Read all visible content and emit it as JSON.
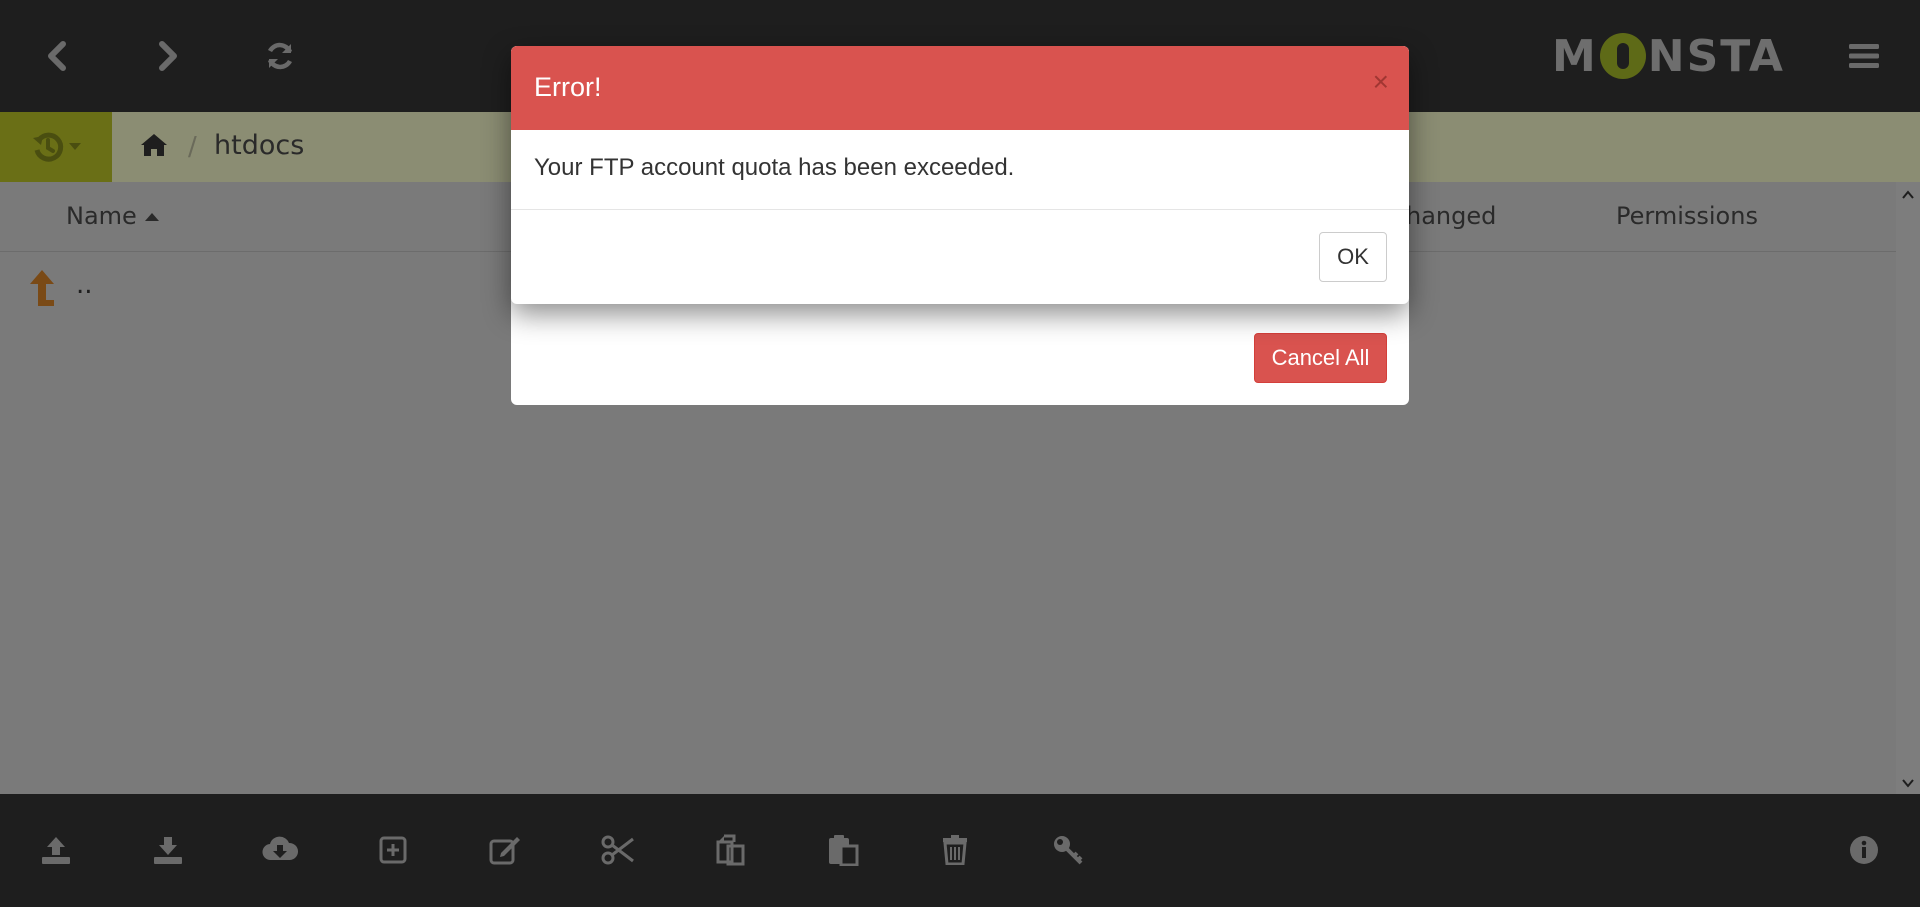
{
  "topbar": {
    "back_icon": "chevron-left-icon",
    "forward_icon": "chevron-right-icon",
    "refresh_icon": "refresh-icon",
    "logo_text_left": "M",
    "logo_text_right": "NSTA",
    "menu_icon": "hamburger-menu-icon"
  },
  "breadcrumb": {
    "history_icon": "history-icon",
    "home_icon": "home-icon",
    "separator": "/",
    "current": "htdocs"
  },
  "file_list": {
    "columns": [
      "Name",
      "hanged",
      "Permissions"
    ],
    "rows": [
      {
        "name": "..",
        "icon": "parent-directory-up-arrow-icon"
      }
    ]
  },
  "bottom_toolbar": {
    "tools": [
      "upload-icon",
      "download-icon",
      "cloud-download-icon",
      "new-item-icon",
      "edit-icon",
      "cut-icon",
      "copy-icon",
      "paste-icon",
      "delete-icon",
      "permissions-key-icon",
      "info-icon"
    ]
  },
  "background_dialog": {
    "cancel_all_label": "Cancel All"
  },
  "error_dialog": {
    "title": "Error!",
    "close_symbol": "×",
    "message": "Your FTP account quota has been exceeded.",
    "ok_label": "OK"
  },
  "colors": {
    "topbar_bg": "#1e1e1e",
    "crumb_bg": "#8b8d73",
    "history_bg": "#6a6f16",
    "error_header": "#d9534f",
    "cancel_button": "#d9534f"
  }
}
